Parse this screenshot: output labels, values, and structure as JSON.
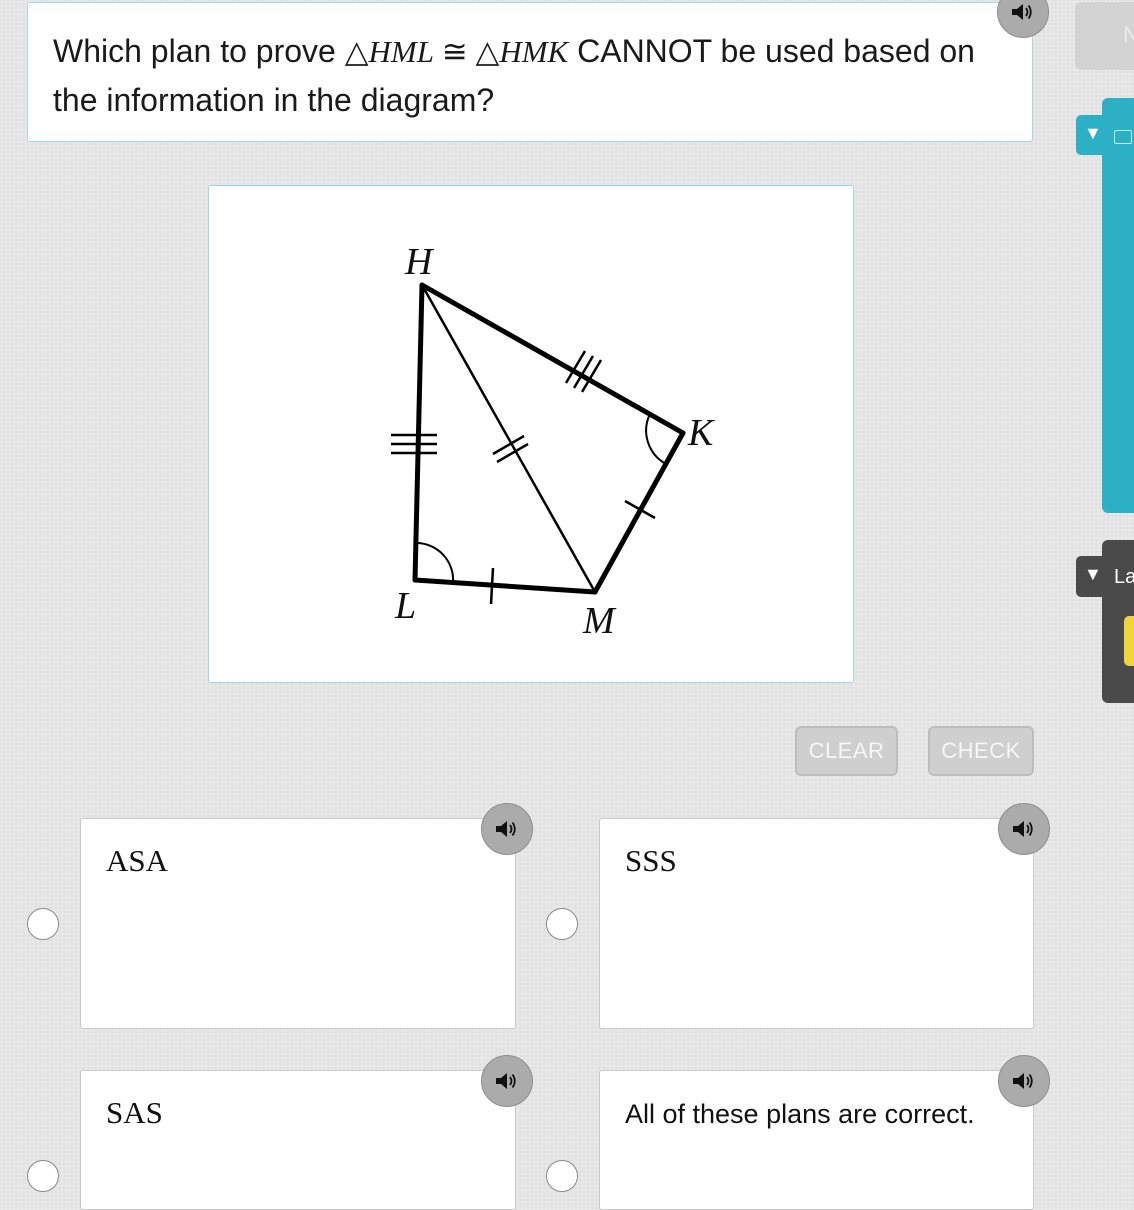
{
  "question": {
    "text_before": "Which plan to prove ",
    "math": {
      "triangle_symbol": "△",
      "first": "HML",
      "congruent_symbol": " ≅ ",
      "second": "HMK"
    },
    "text_after": " CANNOT be used based on the information in the diagram?"
  },
  "diagram": {
    "points": {
      "H": "H",
      "K": "K",
      "L": "L",
      "M": "M"
    }
  },
  "buttons": {
    "clear": "CLEAR",
    "check": "CHECK"
  },
  "choices": [
    {
      "label": "ASA"
    },
    {
      "label": "SSS"
    },
    {
      "label": "SAS"
    },
    {
      "label": "All of these plans are correct."
    }
  ],
  "side_panel": {
    "top_button_text": "N",
    "dark_tab_label": "La"
  },
  "colors": {
    "accent_teal": "#2bb0c6",
    "card_border": "#9fd9e3",
    "speaker_gray": "#ababab",
    "button_gray": "#cfcfcf",
    "dark_panel": "#4a4a4a",
    "yellow": "#f0d53a"
  },
  "icons": {
    "speaker": "speaker-icon",
    "collapse": "triangle-down-icon"
  }
}
